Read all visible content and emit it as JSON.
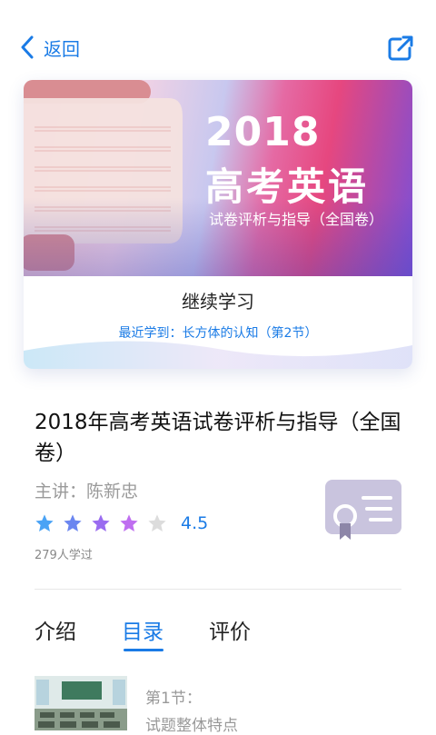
{
  "nav": {
    "back_label": "返回"
  },
  "banner": {
    "year": "2018",
    "subject": "高考英语",
    "subtitle": "试卷评析与指导（全国卷）"
  },
  "continue": {
    "label": "继续学习",
    "recent": "最近学到：长方体的认知（第2节）"
  },
  "course": {
    "title": "2018年高考英语试卷评析与指导（全国卷）",
    "teacher": "主讲：陈新忠",
    "rating": "4.5",
    "rating_value": 4.5,
    "learners": "279人学过"
  },
  "tabs": [
    {
      "label": "介绍"
    },
    {
      "label": "目录"
    },
    {
      "label": "评价"
    }
  ],
  "active_tab": 1,
  "lessons": [
    {
      "number": "第1节：",
      "title": "试题整体特点"
    }
  ],
  "colors": {
    "accent": "#1a7be6",
    "gray_text": "#9a9a9a"
  }
}
